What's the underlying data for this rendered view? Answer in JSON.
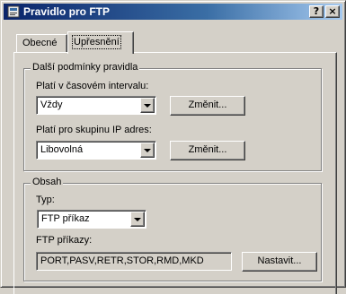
{
  "window": {
    "title": "Pravidlo pro FTP",
    "help_label": "?",
    "close_label": "×"
  },
  "tabs": [
    {
      "label": "Obecné",
      "active": false
    },
    {
      "label": "Upřesnění",
      "active": true
    }
  ],
  "conditions": {
    "title": "Další podmínky pravidla",
    "time_label": "Platí v časovém intervalu:",
    "time_value": "Vždy",
    "time_button": "Změnit...",
    "ip_label": "Platí pro skupinu IP adres:",
    "ip_value": "Libovolná",
    "ip_button": "Změnit..."
  },
  "content": {
    "title": "Obsah",
    "type_label": "Typ:",
    "type_value": "FTP příkaz",
    "commands_label": "FTP příkazy:",
    "commands_value": "PORT,PASV,RETR,STOR,RMD,MKD",
    "set_button": "Nastavit..."
  }
}
